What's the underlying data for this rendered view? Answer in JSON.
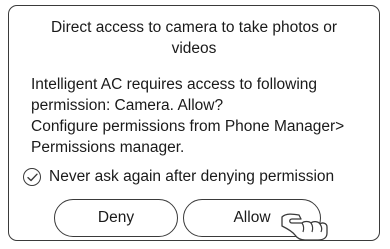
{
  "dialog": {
    "title_lines": [
      "Direct access to camera to take photos or",
      "videos"
    ],
    "message_lines": [
      "Intelligent AC requires access to following",
      "permission: Camera. Allow?",
      "Configure permissions from Phone Manager>",
      "Permissions manager."
    ],
    "checkbox": {
      "label": "Never ask again after denying permission",
      "checked": true,
      "icon": "checkmark-circle-icon"
    },
    "buttons": {
      "deny_label": "Deny",
      "allow_label": "Allow"
    },
    "pointer_icon": "pointing-hand-icon"
  }
}
